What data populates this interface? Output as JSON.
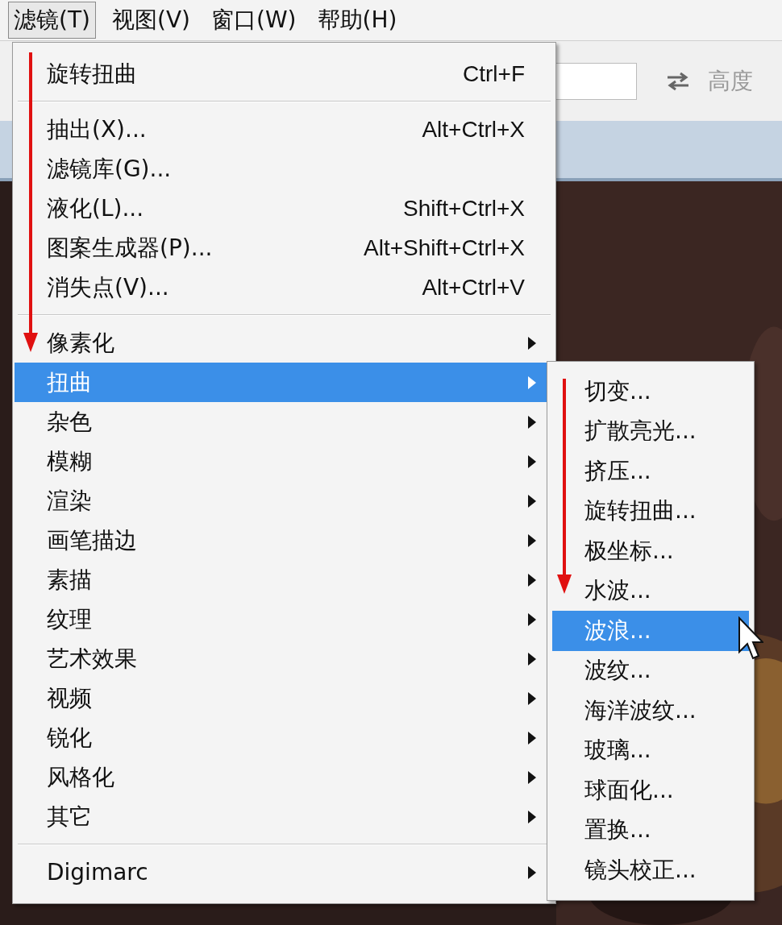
{
  "menubar": [
    {
      "label": "滤镜(T)",
      "selected": true
    },
    {
      "label": "视图(V)",
      "selected": false
    },
    {
      "label": "窗口(W)",
      "selected": false
    },
    {
      "label": "帮助(H)",
      "selected": false
    }
  ],
  "toolbar": {
    "height_label": "高度"
  },
  "filter_menu": {
    "items": [
      {
        "kind": "item",
        "label": "旋转扭曲",
        "shortcut": "Ctrl+F",
        "selected": false
      },
      {
        "kind": "separator"
      },
      {
        "kind": "item",
        "label": "抽出(X)...",
        "shortcut": "Alt+Ctrl+X",
        "selected": false
      },
      {
        "kind": "item",
        "label": "滤镜库(G)...",
        "selected": false
      },
      {
        "kind": "item",
        "label": "液化(L)...",
        "shortcut": "Shift+Ctrl+X",
        "selected": false
      },
      {
        "kind": "item",
        "label": "图案生成器(P)...",
        "shortcut": "Alt+Shift+Ctrl+X",
        "selected": false
      },
      {
        "kind": "item",
        "label": "消失点(V)...",
        "shortcut": "Alt+Ctrl+V",
        "selected": false
      },
      {
        "kind": "separator"
      },
      {
        "kind": "submenu",
        "label": "像素化",
        "selected": false
      },
      {
        "kind": "submenu",
        "label": "扭曲",
        "selected": true
      },
      {
        "kind": "submenu",
        "label": "杂色",
        "selected": false
      },
      {
        "kind": "submenu",
        "label": "模糊",
        "selected": false
      },
      {
        "kind": "submenu",
        "label": "渲染",
        "selected": false
      },
      {
        "kind": "submenu",
        "label": "画笔描边",
        "selected": false
      },
      {
        "kind": "submenu",
        "label": "素描",
        "selected": false
      },
      {
        "kind": "submenu",
        "label": "纹理",
        "selected": false
      },
      {
        "kind": "submenu",
        "label": "艺术效果",
        "selected": false
      },
      {
        "kind": "submenu",
        "label": "视频",
        "selected": false
      },
      {
        "kind": "submenu",
        "label": "锐化",
        "selected": false
      },
      {
        "kind": "submenu",
        "label": "风格化",
        "selected": false
      },
      {
        "kind": "submenu",
        "label": "其它",
        "selected": false
      },
      {
        "kind": "separator"
      },
      {
        "kind": "submenu",
        "label": "Digimarc",
        "selected": false
      }
    ]
  },
  "distort_submenu": {
    "items": [
      {
        "label": "切变...",
        "selected": false
      },
      {
        "label": "扩散亮光...",
        "selected": false
      },
      {
        "label": "挤压...",
        "selected": false
      },
      {
        "label": "旋转扭曲...",
        "selected": false
      },
      {
        "label": "极坐标...",
        "selected": false
      },
      {
        "label": "水波...",
        "selected": false
      },
      {
        "label": "波浪...",
        "selected": true
      },
      {
        "label": "波纹...",
        "selected": false
      },
      {
        "label": "海洋波纹...",
        "selected": false
      },
      {
        "label": "玻璃...",
        "selected": false
      },
      {
        "label": "球面化...",
        "selected": false
      },
      {
        "label": "置换...",
        "selected": false
      },
      {
        "label": "镜头校正...",
        "selected": false
      }
    ]
  }
}
